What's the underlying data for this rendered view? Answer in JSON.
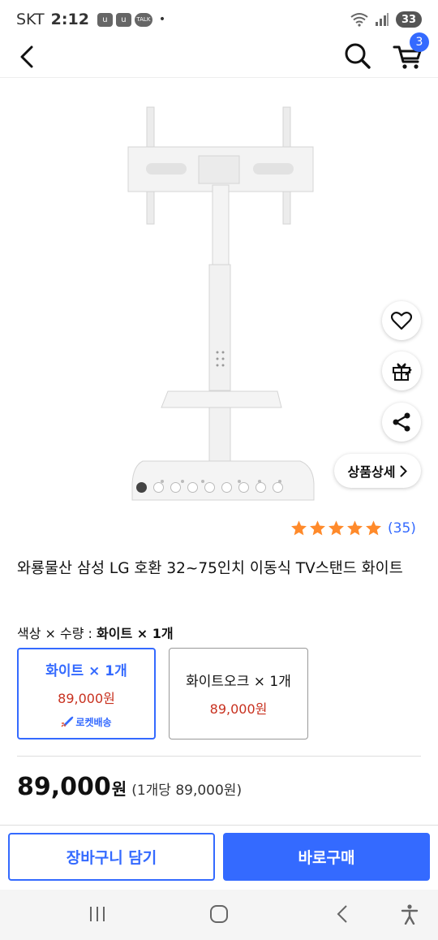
{
  "status_bar": {
    "carrier": "SKT",
    "time": "2:12",
    "notification_icons": [
      "u",
      "u"
    ],
    "talk_badge": "TALK",
    "dot": "•",
    "battery": "33"
  },
  "header": {
    "cart_count": "3"
  },
  "image_carousel": {
    "total_images": 9,
    "active_index": 0
  },
  "side_buttons": {
    "detail_label": "상품상세"
  },
  "rating": {
    "stars": 5,
    "review_count": "(35)"
  },
  "product": {
    "title": "와룡물산 삼성 LG 호환 32~75인치 이동식 TV스탠드 화이트"
  },
  "options": {
    "label_prefix": "색상 × 수량 : ",
    "label_selected": "화이트 × 1개",
    "items": [
      {
        "name": "화이트 × 1개",
        "price": "89,000원",
        "badge": "로켓배송"
      },
      {
        "name": "화이트오크 × 1개",
        "price": "89,000원"
      }
    ]
  },
  "price": {
    "amount": "89,000",
    "unit": "원",
    "per_unit": "(1개당 89,000원)"
  },
  "actions": {
    "add_to_cart": "장바구니 담기",
    "buy_now": "바로구매"
  },
  "colors": {
    "accent": "#346aff",
    "price_red": "#c8311f",
    "star": "#ff8a2b"
  }
}
